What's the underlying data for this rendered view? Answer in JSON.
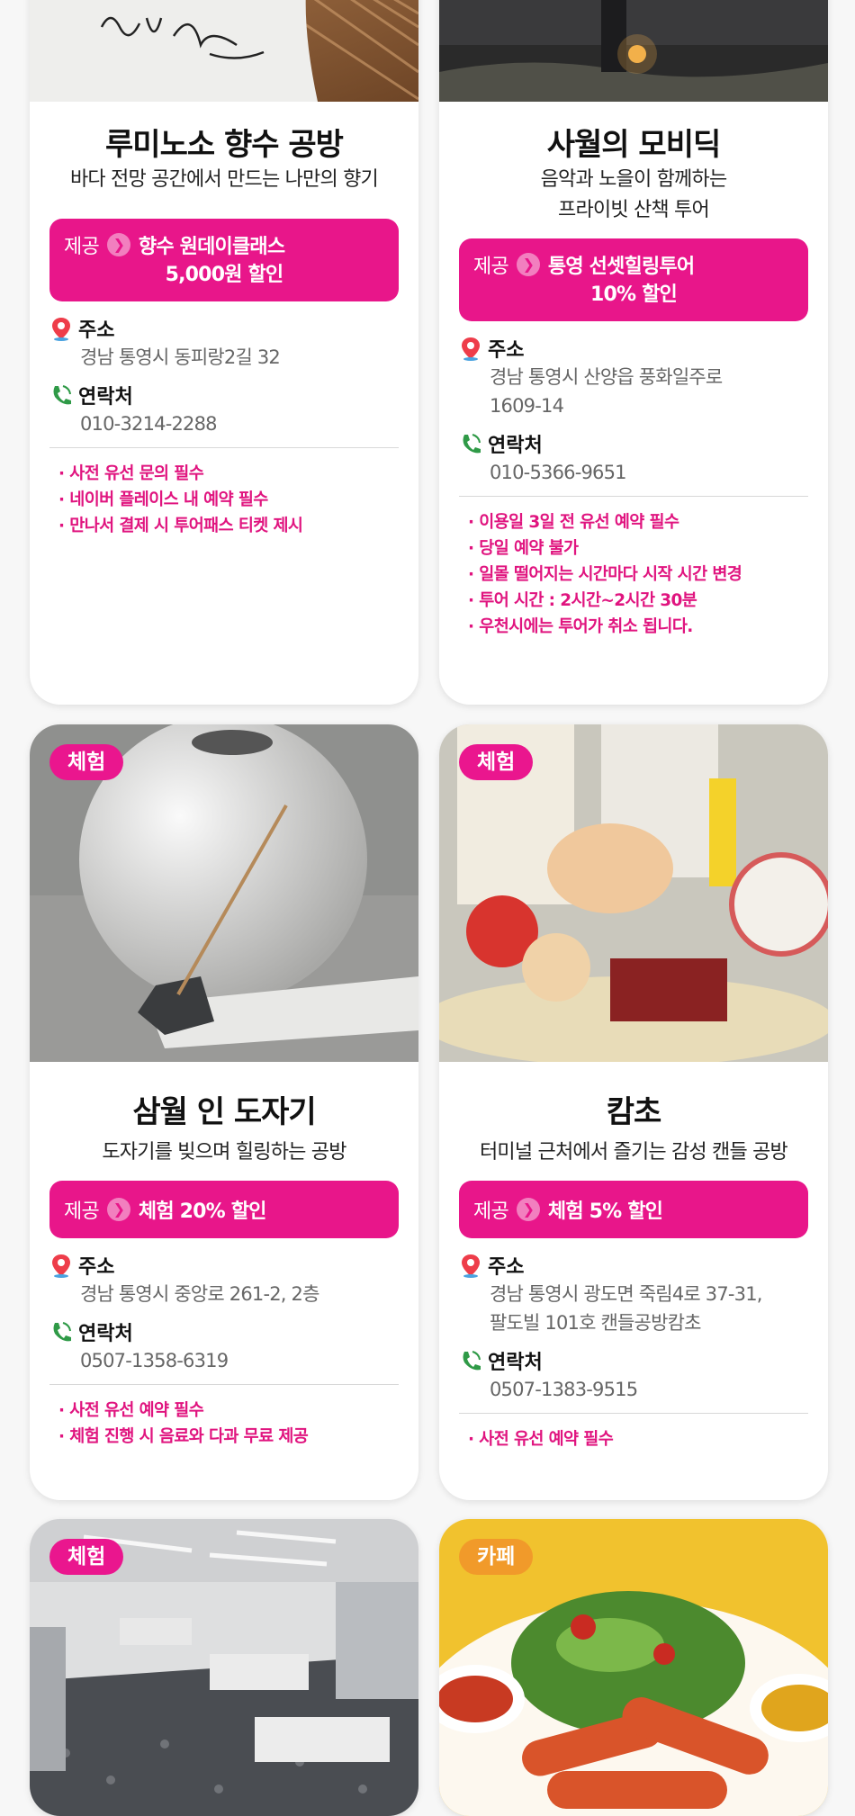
{
  "cards": [
    {
      "title": "루미노소 향수 공방",
      "subtitle": [
        "바다 전망 공간에서 만드는 나만의 향기"
      ],
      "offer_label": "제공",
      "offer_line1": "향수 원데이클래스",
      "offer_line2": "5,000원 할인",
      "address_label": "주소",
      "address": [
        "경남 통영시 동피랑2길 32"
      ],
      "contact_label": "연락처",
      "contact": "010-3214-2288",
      "notes": [
        "· 사전 유선 문의 필수",
        "· 네이버 플레이스 내 예약 필수",
        "· 만나서 결제 시 투어패스 티켓 제시"
      ]
    },
    {
      "title": "사월의 모비딕",
      "subtitle": [
        "음악과 노을이 함께하는",
        "프라이빗 산책 투어"
      ],
      "offer_label": "제공",
      "offer_line1": "통영 선셋힐링투어",
      "offer_line2": "10% 할인",
      "address_label": "주소",
      "address": [
        "경남 통영시 산양읍 풍화일주로",
        "1609-14"
      ],
      "contact_label": "연락처",
      "contact": "010-5366-9651",
      "notes": [
        "· 이용일 3일 전 유선 예약 필수",
        "· 당일 예약 불가",
        "· 일몰 떨어지는 시간마다 시작 시간 변경",
        "· 투어 시간 : 2시간~2시간 30분",
        "· 우천시에는 투어가 취소 됩니다."
      ]
    },
    {
      "badge": "체험",
      "title": "삼월 인 도자기",
      "subtitle": [
        "도자기를 빚으며 힐링하는 공방"
      ],
      "offer_label": "제공",
      "offer_line1": "체험 20% 할인",
      "address_label": "주소",
      "address": [
        "경남 통영시 중앙로 261-2, 2층"
      ],
      "contact_label": "연락처",
      "contact": "0507-1358-6319",
      "notes": [
        "· 사전 유선 예약 필수",
        "· 체험 진행 시 음료와 다과 무료 제공"
      ]
    },
    {
      "badge": "체험",
      "title": "캄초",
      "subtitle": [
        "터미널 근처에서 즐기는 감성 캔들 공방"
      ],
      "offer_label": "제공",
      "offer_line1": "체험 5% 할인",
      "address_label": "주소",
      "address": [
        "경남 통영시 광도면 죽림4로 37-31,",
        "팔도빌 101호 캔들공방캄초"
      ],
      "contact_label": "연락처",
      "contact": "0507-1383-9515",
      "notes": [
        "· 사전 유선 예약 필수"
      ]
    },
    {
      "badge": "체험"
    },
    {
      "badge": "카페"
    }
  ],
  "colors": {
    "accent": "#e8168a",
    "cafe_badge": "#f19a2a",
    "note": "#e0147f"
  },
  "icons": {
    "address": "location-pin-icon",
    "contact": "phone-icon",
    "offer": "chevron-right-icon"
  }
}
